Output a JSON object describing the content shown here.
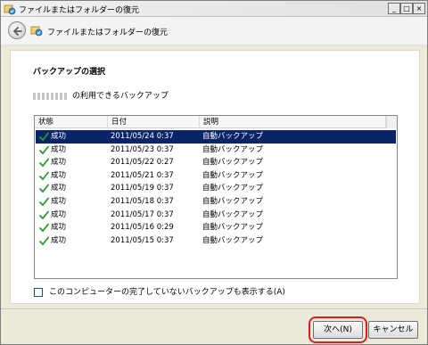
{
  "window": {
    "title": "ファイルまたはフォルダーの復元",
    "controls": {
      "minimize": "_",
      "maximize": "□",
      "close": "×"
    }
  },
  "nav": {
    "title": "ファイルまたはフォルダーの復元",
    "back_icon": "back-arrow-icon"
  },
  "main": {
    "section_title": "バックアップの選択",
    "available_label": "の利用できるバックアップ",
    "list": {
      "columns": [
        "状態",
        "日付",
        "説明"
      ],
      "rows": [
        {
          "status": "成功",
          "date": "2011/05/24 0:37",
          "description": "自動バックアップ",
          "selected": true
        },
        {
          "status": "成功",
          "date": "2011/05/23 0:37",
          "description": "自動バックアップ",
          "selected": false
        },
        {
          "status": "成功",
          "date": "2011/05/22 0:27",
          "description": "自動バックアップ",
          "selected": false
        },
        {
          "status": "成功",
          "date": "2011/05/21 0:37",
          "description": "自動バックアップ",
          "selected": false
        },
        {
          "status": "成功",
          "date": "2011/05/19 0:37",
          "description": "自動バックアップ",
          "selected": false
        },
        {
          "status": "成功",
          "date": "2011/05/18 0:37",
          "description": "自動バックアップ",
          "selected": false
        },
        {
          "status": "成功",
          "date": "2011/05/17 0:37",
          "description": "自動バックアップ",
          "selected": false
        },
        {
          "status": "成功",
          "date": "2011/05/16 0:29",
          "description": "自動バックアップ",
          "selected": false
        },
        {
          "status": "成功",
          "date": "2011/05/15 0:37",
          "description": "自動バックアップ",
          "selected": false
        }
      ]
    },
    "checkbox_label": "このコンピューターの完了していないバックアップも表示する(A)"
  },
  "footer": {
    "next_label": "次へ(N)",
    "cancel_label": "キャンセル"
  },
  "colors": {
    "selection": "#0a246a",
    "success_check": "#2e9a2e",
    "highlight": "#d62020"
  }
}
